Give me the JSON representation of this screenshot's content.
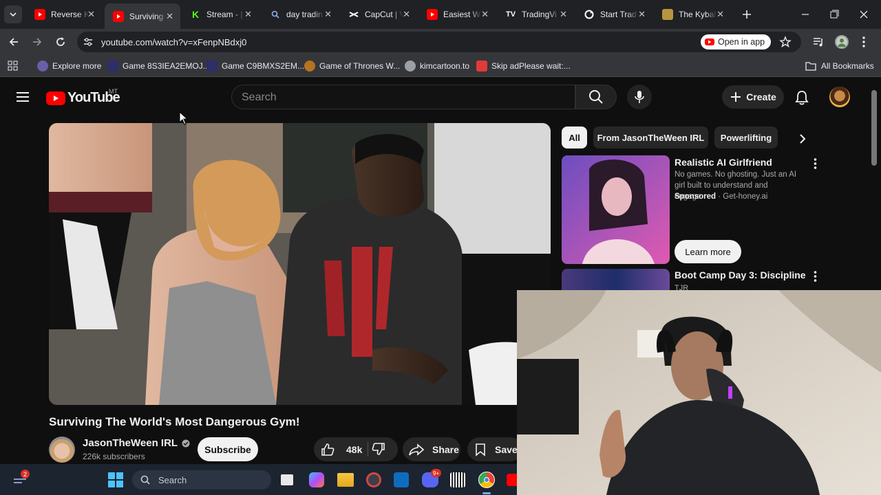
{
  "browser": {
    "tabs": [
      {
        "title": "Reverse K",
        "icon": "youtube-icon"
      },
      {
        "title": "Surviving",
        "icon": "youtube-icon",
        "active": true
      },
      {
        "title": "Stream - |",
        "icon": "kick-icon"
      },
      {
        "title": "day tradin",
        "icon": "search-icon"
      },
      {
        "title": "CapCut | V",
        "icon": "capcut-icon"
      },
      {
        "title": "Easiest W",
        "icon": "youtube-icon"
      },
      {
        "title": "TradingVi",
        "icon": "tradingview-icon"
      },
      {
        "title": "Start Trad",
        "icon": "globe-icon"
      },
      {
        "title": "The Kybal",
        "icon": "kybalion-icon"
      }
    ],
    "url": "youtube.com/watch?v=xFenpNBdxj0",
    "open_in_app": "Open in app",
    "bookmarks": [
      {
        "label": "Explore more"
      },
      {
        "label": "Game 8S3IEA2EMOJ..."
      },
      {
        "label": "Game C9BMXS2EM..."
      },
      {
        "label": "Game of Thrones W..."
      },
      {
        "label": "kimcartoon.to"
      },
      {
        "label": "Skip adPlease wait:..."
      }
    ],
    "all_bookmarks": "All Bookmarks"
  },
  "youtube": {
    "logo_text": "YouTube",
    "region": "MT",
    "search_placeholder": "Search",
    "create_label": "Create",
    "video_title": "Surviving The World's Most Dangerous Gym!",
    "channel_name": "JasonTheWeen IRL",
    "subscribers": "226k subscribers",
    "subscribe_label": "Subscribe",
    "like_count": "48k",
    "share_label": "Share",
    "save_label": "Save",
    "chips": [
      "All",
      "From JasonTheWeen IRL",
      "Powerlifting"
    ],
    "ad": {
      "title": "Realistic AI Girlfriend",
      "desc": "No games. No ghosting. Just an AI girl built to understand and engage.",
      "sponsored": "Sponsored",
      "domain": "Get-honey.ai",
      "cta": "Learn more"
    },
    "next_video": {
      "title": "Boot Camp Day 3: Discipline",
      "channel": "TJR"
    }
  },
  "taskbar": {
    "notification_count": "2",
    "search_placeholder": "Search",
    "discord_badge": "9+"
  },
  "colors": {
    "youtube_red": "#ff0000",
    "chip_active": "#f1f1f1",
    "taskbar": "#1c2430"
  }
}
